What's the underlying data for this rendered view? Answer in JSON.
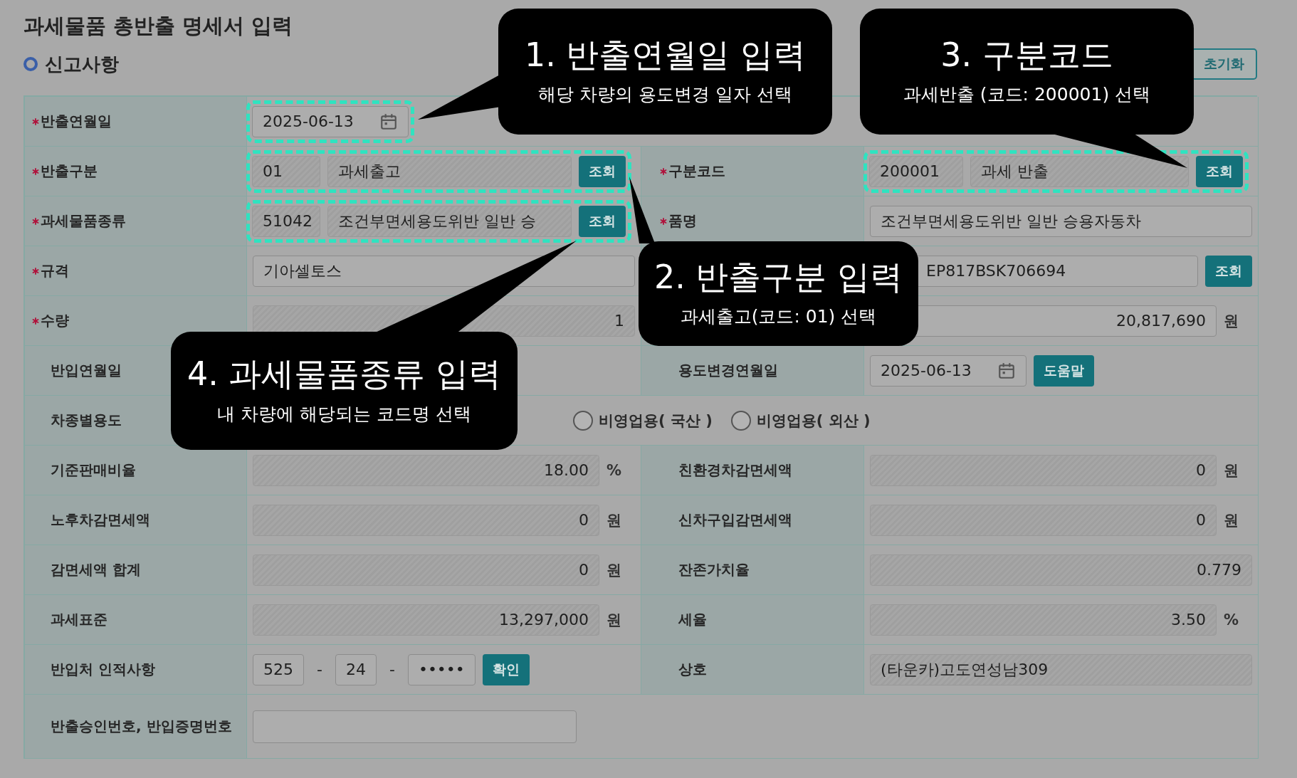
{
  "title": "과세물품 총반출 명세서 입력",
  "section": "신고사항",
  "reset_button": "초기화",
  "rows": [
    {
      "fields": [
        {
          "label": "반출연월일",
          "required": true,
          "highlight": true,
          "control": {
            "kind": "date",
            "value": "2025-06-13"
          }
        }
      ]
    },
    {
      "fields": [
        {
          "label": "반출구분",
          "required": true,
          "highlight": true,
          "control": {
            "kind": "code",
            "code": "01",
            "name": "과세출고",
            "button": "조회"
          }
        },
        {
          "label": "구분코드",
          "required": true,
          "highlight": true,
          "control": {
            "kind": "code",
            "code": "200001",
            "name": "과세 반출",
            "button": "조회"
          }
        }
      ]
    },
    {
      "fields": [
        {
          "label": "과세물품종류",
          "required": true,
          "highlight": true,
          "control": {
            "kind": "code",
            "code": "51042",
            "name": "조건부면세용도위반 일반 승",
            "button": "조회"
          }
        },
        {
          "label": "품명",
          "required": true,
          "control": {
            "kind": "text",
            "value": "조건부면세용도위반 일반 승용자동차"
          }
        }
      ]
    },
    {
      "fields": [
        {
          "label": "규격",
          "required": true,
          "control": {
            "kind": "text",
            "value": "기아셀토스"
          }
        },
        {
          "control": {
            "kind": "text_button",
            "value": "EP817BSK706694",
            "button": "조회"
          }
        }
      ]
    },
    {
      "fields": [
        {
          "label": "수량",
          "required": true,
          "control": {
            "kind": "readonly",
            "value": "1"
          }
        },
        {
          "control": {
            "kind": "number",
            "value": "20,817,690",
            "unit": "원"
          }
        }
      ]
    },
    {
      "fields": [
        {
          "label": "반입연월일"
        },
        {
          "label": "용도변경연월일",
          "control": {
            "kind": "date_button",
            "value": "2025-06-13",
            "button": "도움말"
          }
        }
      ]
    },
    {
      "fields": [
        {
          "label": "차종별용도",
          "control": {
            "kind": "radios",
            "options": [
              {
                "label": "비영업용( 국산 )",
                "selected": false
              },
              {
                "label": "비영업용( 외산 )",
                "selected": false
              }
            ]
          }
        }
      ]
    },
    {
      "fields": [
        {
          "label": "기준판매비율",
          "control": {
            "kind": "readonly",
            "value": "18.00",
            "unit": "%"
          }
        },
        {
          "label": "친환경차감면세액",
          "control": {
            "kind": "readonly",
            "value": "0",
            "unit": "원"
          }
        }
      ]
    },
    {
      "fields": [
        {
          "label": "노후차감면세액",
          "control": {
            "kind": "readonly",
            "value": "0",
            "unit": "원"
          }
        },
        {
          "label": "신차구입감면세액",
          "control": {
            "kind": "readonly",
            "value": "0",
            "unit": "원"
          }
        }
      ]
    },
    {
      "fields": [
        {
          "label": "감면세액 합계",
          "control": {
            "kind": "readonly",
            "value": "0",
            "unit": "원"
          }
        },
        {
          "label": "잔존가치율",
          "control": {
            "kind": "readonly",
            "value": "0.779"
          }
        }
      ]
    },
    {
      "fields": [
        {
          "label": "과세표준",
          "control": {
            "kind": "readonly",
            "value": "13,297,000",
            "unit": "원"
          }
        },
        {
          "label": "세율",
          "control": {
            "kind": "readonly",
            "value": "3.50",
            "unit": "%"
          }
        }
      ]
    },
    {
      "fields": [
        {
          "label": "반입처 인적사항",
          "control": {
            "kind": "biz",
            "parts": [
              {
                "kind": "field",
                "text": "525"
              },
              {
                "kind": "sep",
                "text": "-"
              },
              {
                "kind": "field",
                "text": "24"
              },
              {
                "kind": "sep",
                "text": "-"
              },
              {
                "kind": "field",
                "text": "•••••"
              }
            ],
            "button": "확인"
          }
        },
        {
          "label": "상호",
          "control": {
            "kind": "readonly_text",
            "value": "(타운카)고도연성남309"
          }
        }
      ]
    },
    {
      "fields": [
        {
          "label": "반출승인번호, 반입증명번호",
          "control": {
            "kind": "blank"
          }
        }
      ]
    }
  ],
  "callouts": [
    {
      "title": "1. 반출연월일 입력",
      "text": "해당 차량의 용도변경 일자 선택"
    },
    {
      "title": "3. 구분코드",
      "text": "과세반출 (코드: 200001) 선택"
    },
    {
      "title": "2. 반출구분 입력",
      "text": "과세출고(코드: 01) 선택"
    },
    {
      "title": "4. 과세물품종류 입력",
      "text": "내 차량에 해당되는 코드명 선택"
    }
  ]
}
